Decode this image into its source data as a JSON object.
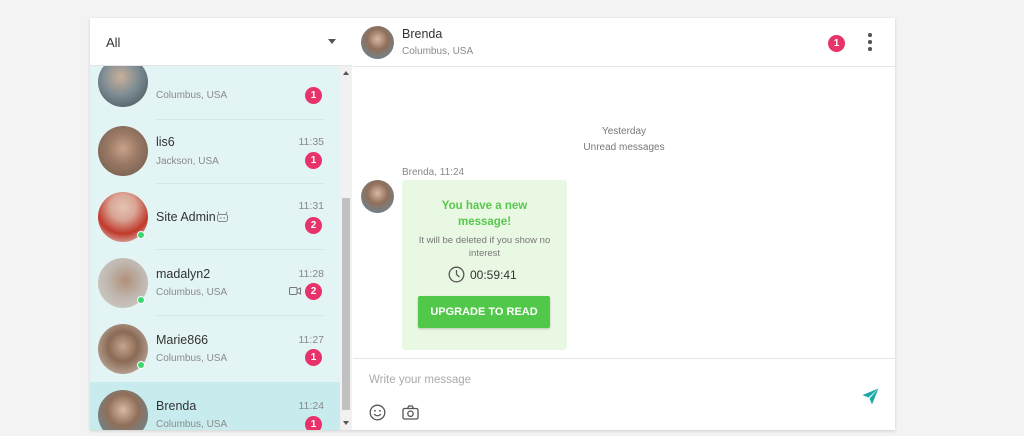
{
  "filter": {
    "selected": "All"
  },
  "conversations": [
    {
      "name": "",
      "location": "Columbus, USA",
      "time": "",
      "badge": "1"
    },
    {
      "name": "lis6",
      "location": "Jackson, USA",
      "time": "11:35",
      "badge": "1"
    },
    {
      "name": "Site Admin",
      "location": "",
      "time": "11:31",
      "badge": "2",
      "icon": "robot-icon"
    },
    {
      "name": "madalyn2",
      "location": "Columbus, USA",
      "time": "11:28",
      "badge": "2",
      "icon": "video-icon"
    },
    {
      "name": "Marie866",
      "location": "Columbus, USA",
      "time": "11:27",
      "badge": "1"
    },
    {
      "name": "Brenda",
      "location": "Columbus, USA",
      "time": "11:24",
      "badge": "1"
    }
  ],
  "chat": {
    "name": "Brenda",
    "location": "Columbus, USA",
    "badge": "1",
    "day_label": "Yesterday",
    "unread_label": "Unread messages",
    "message_meta": "Brenda, 11:24",
    "locked": {
      "title": "You have a new message!",
      "note": "It will be deleted if you show no interest",
      "timer": "00:59:41",
      "button": "UPGRADE TO READ"
    }
  },
  "composer": {
    "placeholder": "Write your message",
    "value": ""
  },
  "colors": {
    "accent_pink": "#e8336a",
    "green": "#52c84a",
    "list_bg": "#e3f4f5",
    "send": "#1aa9a9"
  }
}
